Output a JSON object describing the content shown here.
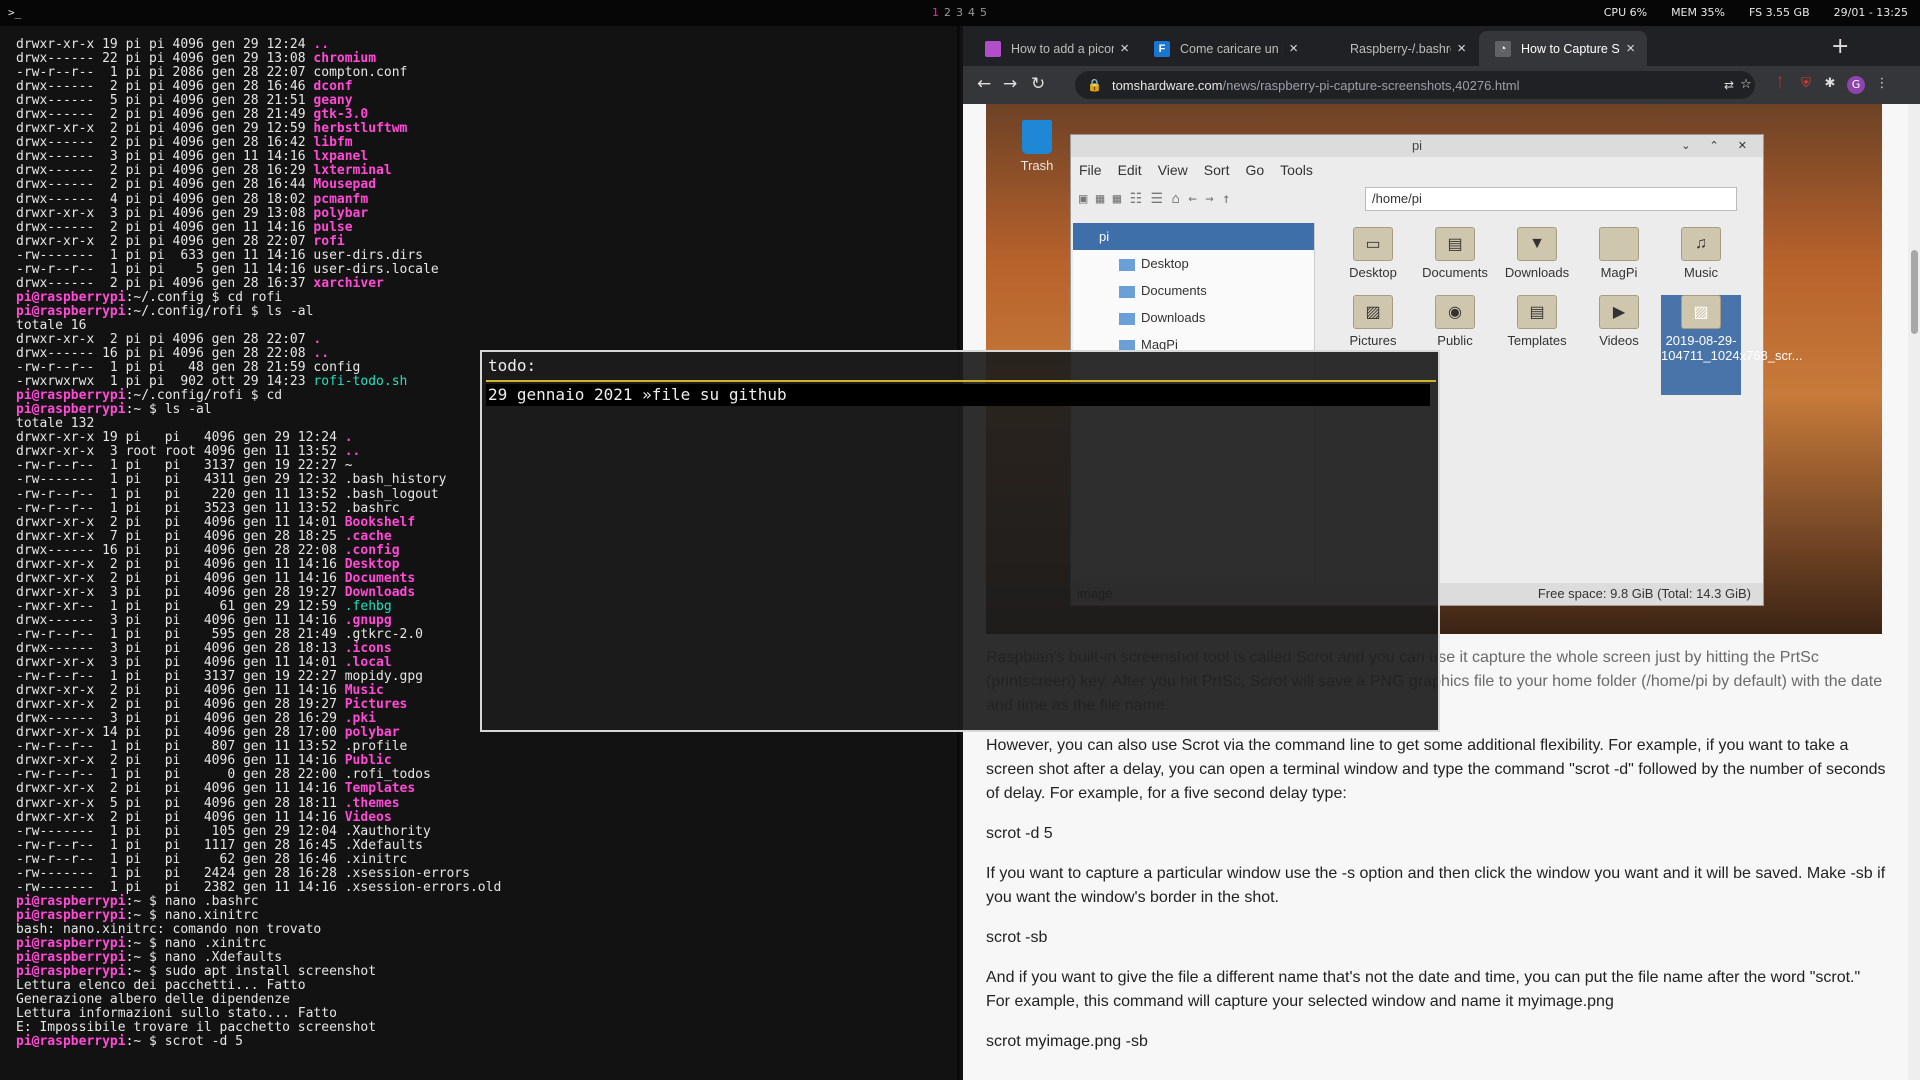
{
  "topbar": {
    "launcher": ">_",
    "workspaces": [
      "1",
      "2",
      "3",
      "4",
      "5"
    ],
    "cpu": "CPU 6%",
    "mem": "MEM 35%",
    "fs": "FS 3.55 GB",
    "clock": "29/01 - 13:25"
  },
  "terminal": {
    "lines": [
      {
        "t": "drwxr-xr-x 19 pi pi 4096 gen 29 12:24 ",
        "h": ".."
      },
      {
        "t": "drwx------ 22 pi pi 4096 gen 29 13:08 ",
        "h": "chromium"
      },
      {
        "t": "-rw-r--r--  1 pi pi 2086 gen 28 22:07 ",
        "h": "compton.conf",
        "plain": true
      },
      {
        "t": "drwx------  2 pi pi 4096 gen 28 16:46 ",
        "h": "dconf"
      },
      {
        "t": "drwx------  5 pi pi 4096 gen 28 21:51 ",
        "h": "geany"
      },
      {
        "t": "drwx------  2 pi pi 4096 gen 28 21:49 ",
        "h": "gtk-3.0"
      },
      {
        "t": "drwxr-xr-x  2 pi pi 4096 gen 29 12:59 ",
        "h": "herbstluftwm"
      },
      {
        "t": "drwx------  2 pi pi 4096 gen 28 16:42 ",
        "h": "libfm"
      },
      {
        "t": "drwx------  3 pi pi 4096 gen 11 14:16 ",
        "h": "lxpanel"
      },
      {
        "t": "drwx------  2 pi pi 4096 gen 28 16:29 ",
        "h": "lxterminal"
      },
      {
        "t": "drwx------  2 pi pi 4096 gen 28 16:44 ",
        "h": "Mousepad"
      },
      {
        "t": "drwx------  4 pi pi 4096 gen 28 18:02 ",
        "h": "pcmanfm"
      },
      {
        "t": "drwxr-xr-x  3 pi pi 4096 gen 29 13:08 ",
        "h": "polybar"
      },
      {
        "t": "drwx------  2 pi pi 4096 gen 11 14:16 ",
        "h": "pulse"
      },
      {
        "t": "drwxr-xr-x  2 pi pi 4096 gen 28 22:07 ",
        "h": "rofi"
      },
      {
        "t": "-rw-------  1 pi pi  633 gen 11 14:16 ",
        "h": "user-dirs.dirs",
        "plain": true
      },
      {
        "t": "-rw-r--r--  1 pi pi    5 gen 11 14:16 ",
        "h": "user-dirs.locale",
        "plain": true
      },
      {
        "t": "drwx------  2 pi pi 4096 gen 28 16:37 ",
        "h": "xarchiver"
      },
      {
        "p": "pi@raspberrypi",
        "d": ":~/.config $ ",
        "c": "cd rofi"
      },
      {
        "p": "pi@raspberrypi",
        "d": ":~/.config/rofi $ ",
        "c": "ls -al"
      },
      {
        "t": "totale 16",
        "h": "",
        "plain": true
      },
      {
        "t": "drwxr-xr-x  2 pi pi 4096 gen 28 22:07 ",
        "h": "."
      },
      {
        "t": "drwx------ 16 pi pi 4096 gen 28 22:08 ",
        "h": ".."
      },
      {
        "t": "-rw-r--r--  1 pi pi   48 gen 28 21:59 ",
        "h": "config",
        "plain": true
      },
      {
        "t": "-rwxrwxrwx  1 pi pi  902 ott 29 14:23 ",
        "h": "rofi-todo.sh",
        "green": true
      },
      {
        "p": "pi@raspberrypi",
        "d": ":~/.config/rofi $ ",
        "c": "cd"
      },
      {
        "p": "pi@raspberrypi",
        "d": ":~ $ ",
        "c": "ls -al"
      },
      {
        "t": "totale 132",
        "h": "",
        "plain": true
      },
      {
        "t": "drwxr-xr-x 19 pi   pi   4096 gen 29 12:24 ",
        "h": "."
      },
      {
        "t": "drwxr-xr-x  3 root root 4096 gen 11 13:52 ",
        "h": ".."
      },
      {
        "t": "-rw-r--r--  1 pi   pi   3137 gen 19 22:27 ",
        "h": "~",
        "plain": true
      },
      {
        "t": "-rw-------  1 pi   pi   4311 gen 29 12:32 ",
        "h": ".bash_history",
        "plain": true
      },
      {
        "t": "-rw-r--r--  1 pi   pi    220 gen 11 13:52 ",
        "h": ".bash_logout",
        "plain": true
      },
      {
        "t": "-rw-r--r--  1 pi   pi   3523 gen 11 13:52 ",
        "h": ".bashrc",
        "plain": true
      },
      {
        "t": "drwxr-xr-x  2 pi   pi   4096 gen 11 14:01 ",
        "h": "Bookshelf"
      },
      {
        "t": "drwxr-xr-x  7 pi   pi   4096 gen 28 18:25 ",
        "h": ".cache"
      },
      {
        "t": "drwx------ 16 pi   pi   4096 gen 28 22:08 ",
        "h": ".config"
      },
      {
        "t": "drwxr-xr-x  2 pi   pi   4096 gen 11 14:16 ",
        "h": "Desktop"
      },
      {
        "t": "drwxr-xr-x  2 pi   pi   4096 gen 11 14:16 ",
        "h": "Documents"
      },
      {
        "t": "drwxr-xr-x  3 pi   pi   4096 gen 28 19:27 ",
        "h": "Downloads"
      },
      {
        "t": "-rwxr-xr--  1 pi   pi     61 gen 29 12:59 ",
        "h": ".fehbg",
        "green": true
      },
      {
        "t": "drwx------  3 pi   pi   4096 gen 11 14:16 ",
        "h": ".gnupg"
      },
      {
        "t": "-rw-r--r--  1 pi   pi    595 gen 28 21:49 ",
        "h": ".gtkrc-2.0",
        "plain": true
      },
      {
        "t": "drwx------  3 pi   pi   4096 gen 28 18:13 ",
        "h": ".icons"
      },
      {
        "t": "drwxr-xr-x  3 pi   pi   4096 gen 11 14:01 ",
        "h": ".local"
      },
      {
        "t": "-rw-r--r--  1 pi   pi   3137 gen 19 22:27 ",
        "h": "mopidy.gpg",
        "plain": true
      },
      {
        "t": "drwxr-xr-x  2 pi   pi   4096 gen 11 14:16 ",
        "h": "Music"
      },
      {
        "t": "drwxr-xr-x  2 pi   pi   4096 gen 28 19:27 ",
        "h": "Pictures"
      },
      {
        "t": "drwx------  3 pi   pi   4096 gen 28 16:29 ",
        "h": ".pki"
      },
      {
        "t": "drwxr-xr-x 14 pi   pi   4096 gen 28 17:00 ",
        "h": "polybar"
      },
      {
        "t": "-rw-r--r--  1 pi   pi    807 gen 11 13:52 ",
        "h": ".profile",
        "plain": true
      },
      {
        "t": "drwxr-xr-x  2 pi   pi   4096 gen 11 14:16 ",
        "h": "Public"
      },
      {
        "t": "-rw-r--r--  1 pi   pi      0 gen 28 22:00 ",
        "h": ".rofi_todos",
        "plain": true
      },
      {
        "t": "drwxr-xr-x  2 pi   pi   4096 gen 11 14:16 ",
        "h": "Templates"
      },
      {
        "t": "drwxr-xr-x  5 pi   pi   4096 gen 28 18:11 ",
        "h": ".themes"
      },
      {
        "t": "drwxr-xr-x  2 pi   pi   4096 gen 11 14:16 ",
        "h": "Videos"
      },
      {
        "t": "-rw-------  1 pi   pi    105 gen 29 12:04 ",
        "h": ".Xauthority",
        "plain": true
      },
      {
        "t": "-rw-r--r--  1 pi   pi   1117 gen 28 16:45 ",
        "h": ".Xdefaults",
        "plain": true
      },
      {
        "t": "-rw-r--r--  1 pi   pi     62 gen 28 16:46 ",
        "h": ".xinitrc",
        "plain": true
      },
      {
        "t": "-rw-------  1 pi   pi   2424 gen 28 16:28 ",
        "h": ".xsession-errors",
        "plain": true
      },
      {
        "t": "-rw-------  1 pi   pi   2382 gen 11 14:16 ",
        "h": ".xsession-errors.old",
        "plain": true
      },
      {
        "p": "pi@raspberrypi",
        "d": ":~ $ ",
        "c": "nano .bashrc"
      },
      {
        "p": "pi@raspberrypi",
        "d": ":~ $ ",
        "c": "nano.xinitrc"
      },
      {
        "t": "bash: nano.xinitrc: comando non trovato",
        "h": "",
        "plain": true
      },
      {
        "p": "pi@raspberrypi",
        "d": ":~ $ ",
        "c": "nano .xinitrc"
      },
      {
        "p": "pi@raspberrypi",
        "d": ":~ $ ",
        "c": "nano .Xdefaults"
      },
      {
        "p": "pi@raspberrypi",
        "d": ":~ $ ",
        "c": "sudo apt install screenshot"
      },
      {
        "t": "Lettura elenco dei pacchetti... Fatto",
        "h": "",
        "plain": true
      },
      {
        "t": "Generazione albero delle dipendenze",
        "h": "",
        "plain": true
      },
      {
        "t": "Lettura informazioni sullo stato... Fatto",
        "h": "",
        "plain": true
      },
      {
        "t": "E: Impossibile trovare il pacchetto screenshot",
        "h": "",
        "plain": true
      },
      {
        "p": "pi@raspberrypi",
        "d": ":~ $ ",
        "c": "scrot -d 5"
      }
    ]
  },
  "browser": {
    "tabs": [
      {
        "title": "How to add a picom toggle to",
        "color": "#b04fc9",
        "glyph": ""
      },
      {
        "title": "Come caricare un progetto su",
        "color": "#1976d2",
        "glyph": "F"
      },
      {
        "title": "Raspberry-/.bashrc(no alias)",
        "color": "#202124",
        "glyph": ""
      },
      {
        "title": "How to Capture Screenshots",
        "color": "#5f6368",
        "glyph": "◔",
        "active": true
      }
    ],
    "url_host": "tomshardware.com",
    "url_path": "/news/raspberry-pi-capture-screenshots,40276.html",
    "filemanager": {
      "title": "pi",
      "menu": [
        "File",
        "Edit",
        "View",
        "Sort",
        "Go",
        "Tools"
      ],
      "path": "/home/pi",
      "tree": [
        {
          "label": "pi",
          "sel": true
        },
        {
          "label": "Desktop"
        },
        {
          "label": "Documents"
        },
        {
          "label": "Downloads"
        },
        {
          "label": "MagPi"
        }
      ],
      "icons": [
        {
          "label": "Desktop",
          "g": "▭"
        },
        {
          "label": "Documents",
          "g": "▤"
        },
        {
          "label": "Downloads",
          "g": "▼"
        },
        {
          "label": "MagPi",
          "g": ""
        },
        {
          "label": "Music",
          "g": "♫"
        },
        {
          "label": "Pictures",
          "g": "▨"
        },
        {
          "label": "Public",
          "g": "◉"
        },
        {
          "label": "Templates",
          "g": "▤"
        },
        {
          "label": "Videos",
          "g": "▶"
        },
        {
          "label": "2019-08-29-104711_1024x768_scr...",
          "g": "▨",
          "sel": true
        }
      ],
      "status_left": "image",
      "status_right": "Free space: 9.8 GiB (Total: 14.3 GiB)",
      "trash": "Trash"
    },
    "article": [
      "Raspbian's built-in screenshot tool is called Scrot and you can use it capture the whole screen just by hitting the PrtSc (printscreen) key. After you hit PrtSc, Scrot will save a PNG graphics file to your home folder (/home/pi by default) with the date and time as the file name.",
      "However, you can also use Scrot via the command line to get some additional flexibility. For example, if you want to take a screen shot after a delay, you can open a terminal window and type the command \"scrot -d\" followed by the number of seconds of delay. For example, for a five second delay type:",
      "scrot -d 5",
      "If you want to capture a particular window use the -s option and then click the window you want and it will be saved. Make -sb if you want the window's border in the shot.",
      "scrot -sb",
      "And if you want to give the file a different name that's not the date and time, you can put the file name after the word \"scrot.\" For example, this command will capture your selected window and name it myimage.png",
      "scrot myimage.png -sb"
    ]
  },
  "rofi": {
    "prompt": "todo:",
    "entry": "29 gennaio 2021 »file su github"
  }
}
